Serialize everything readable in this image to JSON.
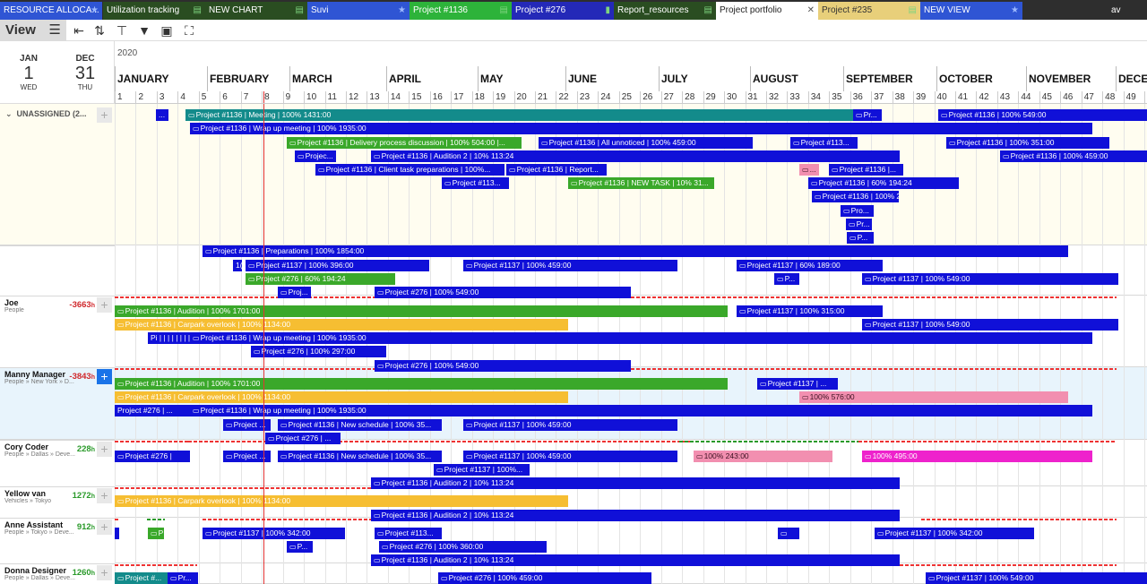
{
  "tabs": [
    {
      "label": "RESOURCE ALLOCA...",
      "icon": "★",
      "bg": "#2f55d4",
      "fg": "#fff"
    },
    {
      "label": "Utilization tracking",
      "icon": "▤",
      "bg": "#2a4d21",
      "fg": "#fff"
    },
    {
      "label": "NEW CHART",
      "icon": "▤",
      "bg": "#2a4d21",
      "fg": "#fff"
    },
    {
      "label": "Suvi",
      "icon": "★",
      "bg": "#2f55d4",
      "fg": "#fff"
    },
    {
      "label": "Project #1136",
      "icon": "▤",
      "bg": "#2db33a",
      "fg": "#fff"
    },
    {
      "label": "Project #276",
      "icon": "▮",
      "bg": "#2429b8",
      "fg": "#fff"
    },
    {
      "label": "Report_resources",
      "icon": "▤",
      "bg": "#2a4d21",
      "fg": "#fff"
    },
    {
      "label": "Project portfolio",
      "icon": "✕",
      "bg": "#ffffff",
      "fg": "#222"
    },
    {
      "label": "Project #235",
      "icon": "▤",
      "bg": "#e8cf7a",
      "fg": "#333"
    },
    {
      "label": "NEW VIEW",
      "icon": "★",
      "bg": "#2f55d4",
      "fg": "#fff"
    },
    {
      "label": "av",
      "icon": "",
      "bg": "#2e2e2e",
      "fg": "#fff"
    }
  ],
  "toolbar": {
    "view_label": "View",
    "icons": [
      "menu-icon",
      "collapse-icon",
      "sort-icon",
      "paint-icon",
      "filter-icon",
      "calendar-add-icon",
      "fullscreen-icon"
    ]
  },
  "date_range": {
    "start": {
      "month": "JAN",
      "day": "1",
      "weekday": "WED"
    },
    "end": {
      "month": "DEC",
      "day": "31",
      "weekday": "THU"
    }
  },
  "timeline": {
    "year": "2020",
    "months": [
      "JANUARY",
      "FEBRUARY",
      "MARCH",
      "APRIL",
      "MAY",
      "JUNE",
      "JULY",
      "AUGUST",
      "SEPTEMBER",
      "OCTOBER",
      "NOVEMBER",
      "DECE"
    ],
    "weeks": [
      "1",
      "2",
      "3",
      "4",
      "5",
      "6",
      "7",
      "8",
      "9",
      "10",
      "11",
      "12",
      "13",
      "14",
      "15",
      "16",
      "17",
      "18",
      "19",
      "20",
      "21",
      "22",
      "23",
      "24",
      "25",
      "26",
      "27",
      "28",
      "29",
      "30",
      "31",
      "32",
      "33",
      "34",
      "35",
      "36",
      "37",
      "38",
      "39",
      "40",
      "41",
      "42",
      "43",
      "44",
      "45",
      "46",
      "47",
      "48",
      "49",
      "50"
    ]
  },
  "colors": {
    "blue": "#1010d8",
    "teal": "#138b8b",
    "green": "#3aa82a",
    "yellow": "#f6be32",
    "pink": "#f28fb0",
    "magenta": "#ee22cc",
    "today": "#e33333"
  },
  "unassigned": {
    "label": "UNASSIGNED (2..."
  },
  "resources": [
    {
      "name": "Joe",
      "sub": "People",
      "hours": "-3663",
      "unit": "h",
      "hours_color": "#d0282c"
    },
    {
      "name": "Manny Manager",
      "sub": "People » New York » D...",
      "hours": "-3843",
      "unit": "h",
      "hours_color": "#d0282c"
    },
    {
      "name": "Cory Coder",
      "sub": "People » Dallas » Deve...",
      "hours": "228",
      "unit": "h",
      "hours_color": "#2a9a2a"
    },
    {
      "name": "Yellow van",
      "sub": "Vehicles » Tokyo",
      "hours": "1272",
      "unit": "h",
      "hours_color": "#2a9a2a"
    },
    {
      "name": "Anne Assistant",
      "sub": "People » Tokyo » Deve...",
      "hours": "912",
      "unit": "h",
      "hours_color": "#2a9a2a"
    },
    {
      "name": "Donna Designer",
      "sub": "People » Dallas » Deve...",
      "hours": "1260",
      "unit": "h",
      "hours_color": "#2a9a2a"
    }
  ],
  "bars": [
    {
      "text": "...",
      "c": "blue",
      "icon": 0
    },
    {
      "text": "Project #1136 | Meeting | 100% 1431:00",
      "c": "teal",
      "icon": 1
    },
    {
      "text": "Pr...",
      "c": "blue",
      "icon": 1
    },
    {
      "text": "Project #1136 | 100% 549:00",
      "c": "blue",
      "icon": 1
    },
    {
      "text": "Project #1136 | Wrap up meeting | 100% 1935:00",
      "c": "blue",
      "icon": 1
    },
    {
      "text": "Project #1136 | Delivery process discussion | 100% 504:00 |...",
      "c": "green",
      "icon": 1
    },
    {
      "text": "Project #1136 | All unnoticed | 100% 459:00",
      "c": "blue",
      "icon": 1
    },
    {
      "text": "Project #113...",
      "c": "blue",
      "icon": 1
    },
    {
      "text": "Project #1136 | 100% 351:00",
      "c": "blue",
      "icon": 1
    },
    {
      "text": "Projec...",
      "c": "blue",
      "icon": 1
    },
    {
      "text": "Project #1136 | Audition 2 | 10% 113:24",
      "c": "blue",
      "icon": 1
    },
    {
      "text": "Project #1136 | 100% 459:00",
      "c": "blue",
      "icon": 1
    },
    {
      "text": "Project #1136 | Client task preparations | 100%...",
      "c": "blue",
      "icon": 1
    },
    {
      "text": "Project #1136 | Report...",
      "c": "blue",
      "icon": 1
    },
    {
      "text": "...",
      "c": "pink",
      "icon": 1
    },
    {
      "text": "Project #1136 |...",
      "c": "blue",
      "icon": 1
    },
    {
      "text": "Project #113...",
      "c": "blue",
      "icon": 1
    },
    {
      "text": "Project #1136 | NEW TASK | 10% 31...",
      "c": "green",
      "icon": 1
    },
    {
      "text": "Project #1136 | 60% 194:24",
      "c": "blue",
      "icon": 1
    },
    {
      "text": "Project #1136 | 100% 297:00",
      "c": "blue",
      "icon": 1
    },
    {
      "text": "Pro...",
      "c": "blue",
      "icon": 1
    },
    {
      "text": "Pr...",
      "c": "blue",
      "icon": 1
    },
    {
      "text": "P...",
      "c": "blue",
      "icon": 1
    },
    {
      "text": "Project #1136 | Preparations | 100% 1854:00",
      "c": "blue",
      "icon": 1
    },
    {
      "text": "1(",
      "c": "blue",
      "icon": 0
    },
    {
      "text": "Project #1137 | 100% 396:00",
      "c": "blue",
      "icon": 1
    },
    {
      "text": "Project #1137 | 100% 459:00",
      "c": "blue",
      "icon": 1
    },
    {
      "text": "Project #1137 | 60% 189:00",
      "c": "blue",
      "icon": 1
    },
    {
      "text": "Project #276 | 60% 194:24",
      "c": "green",
      "icon": 1
    },
    {
      "text": "P...",
      "c": "blue",
      "icon": 1
    },
    {
      "text": "Project #1137 | 100% 549:00",
      "c": "blue",
      "icon": 1
    },
    {
      "text": "Proj...",
      "c": "blue",
      "icon": 1
    },
    {
      "text": "Project #276 | 100% 549:00",
      "c": "blue",
      "icon": 1
    },
    {
      "text": "Project #1136 | Audition | 100% 1701:00",
      "c": "green",
      "icon": 1
    },
    {
      "text": "Project #1137 | 100% 315:00",
      "c": "blue",
      "icon": 1
    },
    {
      "text": "Project #1136 | Carpark overlook | 100% 1134:00",
      "c": "yellow",
      "icon": 1
    },
    {
      "text": "Project #1137 | 100% 549:00",
      "c": "blue",
      "icon": 1
    },
    {
      "text": "Pi | | | | | | | | |",
      "c": "blue",
      "icon": 0
    },
    {
      "text": "Project #1136 | Wrap up meeting | 100% 1935:00",
      "c": "blue",
      "icon": 1
    },
    {
      "text": "Project #276 | 100% 297:00",
      "c": "blue",
      "icon": 1
    },
    {
      "text": "Project #276 | 100% 549:00",
      "c": "blue",
      "icon": 1
    },
    {
      "text": "Project #1136 | Audition | 100% 1701:00",
      "c": "green",
      "icon": 1
    },
    {
      "text": "Project #1137 | ...",
      "c": "blue",
      "icon": 1
    },
    {
      "text": "Project #1136 | Carpark overlook | 100% 1134:00",
      "c": "yellow",
      "icon": 1
    },
    {
      "text": "100% 576:00",
      "c": "pink",
      "icon": 1
    },
    {
      "text": "Project #276 | ...",
      "c": "blue",
      "icon": 0
    },
    {
      "text": "Project #1136 | Wrap up meeting | 100% 1935:00",
      "c": "blue",
      "icon": 1
    },
    {
      "text": "Project ...",
      "c": "blue",
      "icon": 1
    },
    {
      "text": "Project #1136 | New schedule | 100% 35...",
      "c": "blue",
      "icon": 1
    },
    {
      "text": "Project #1137 | 100% 459:00",
      "c": "blue",
      "icon": 1
    },
    {
      "text": "Project #276 | ...",
      "c": "blue",
      "icon": 1
    },
    {
      "text": "Project #276 |",
      "c": "blue",
      "icon": 1
    },
    {
      "text": "Project ...",
      "c": "blue",
      "icon": 1
    },
    {
      "text": "Project #1136 | New schedule | 100% 35...",
      "c": "blue",
      "icon": 1
    },
    {
      "text": "Project #1137 | 100% 459:00",
      "c": "blue",
      "icon": 1
    },
    {
      "text": "100% 243:00",
      "c": "pink",
      "icon": 1
    },
    {
      "text": "100% 495:00",
      "c": "magenta",
      "icon": 1
    },
    {
      "text": "Project #1137 | 100%...",
      "c": "blue",
      "icon": 1
    },
    {
      "text": "Project #1136 | Audition 2 | 10% 113:24",
      "c": "blue",
      "icon": 1
    },
    {
      "text": "Project #1136 | Carpark overlook | 100% 1134:00",
      "c": "yellow",
      "icon": 1
    },
    {
      "text": "Project #1136 | Audition 2 | 10% 113:24",
      "c": "blue",
      "icon": 1
    },
    {
      "text": "",
      "c": "blue",
      "icon": 0
    },
    {
      "text": "P",
      "c": "green",
      "icon": 1
    },
    {
      "text": "Project #1137 | 100% 342:00",
      "c": "blue",
      "icon": 1
    },
    {
      "text": "Project #113...",
      "c": "blue",
      "icon": 1
    },
    {
      "text": "",
      "c": "blue",
      "icon": 1
    },
    {
      "text": "Project #1137 | 100% 342:00",
      "c": "blue",
      "icon": 1
    },
    {
      "text": "P...",
      "c": "blue",
      "icon": 1
    },
    {
      "text": "Project #276 | 100% 360:00",
      "c": "blue",
      "icon": 1
    },
    {
      "text": "Project #1136 | Audition 2 | 10% 113:24",
      "c": "blue",
      "icon": 1
    },
    {
      "text": "Project #...",
      "c": "teal",
      "icon": 1
    },
    {
      "text": "Pr...",
      "c": "blue",
      "icon": 1
    },
    {
      "text": "Project #276 | 100% 459:00",
      "c": "blue",
      "icon": 1
    },
    {
      "text": "Project #1137 | 100% 549:00",
      "c": "blue",
      "icon": 1
    }
  ]
}
